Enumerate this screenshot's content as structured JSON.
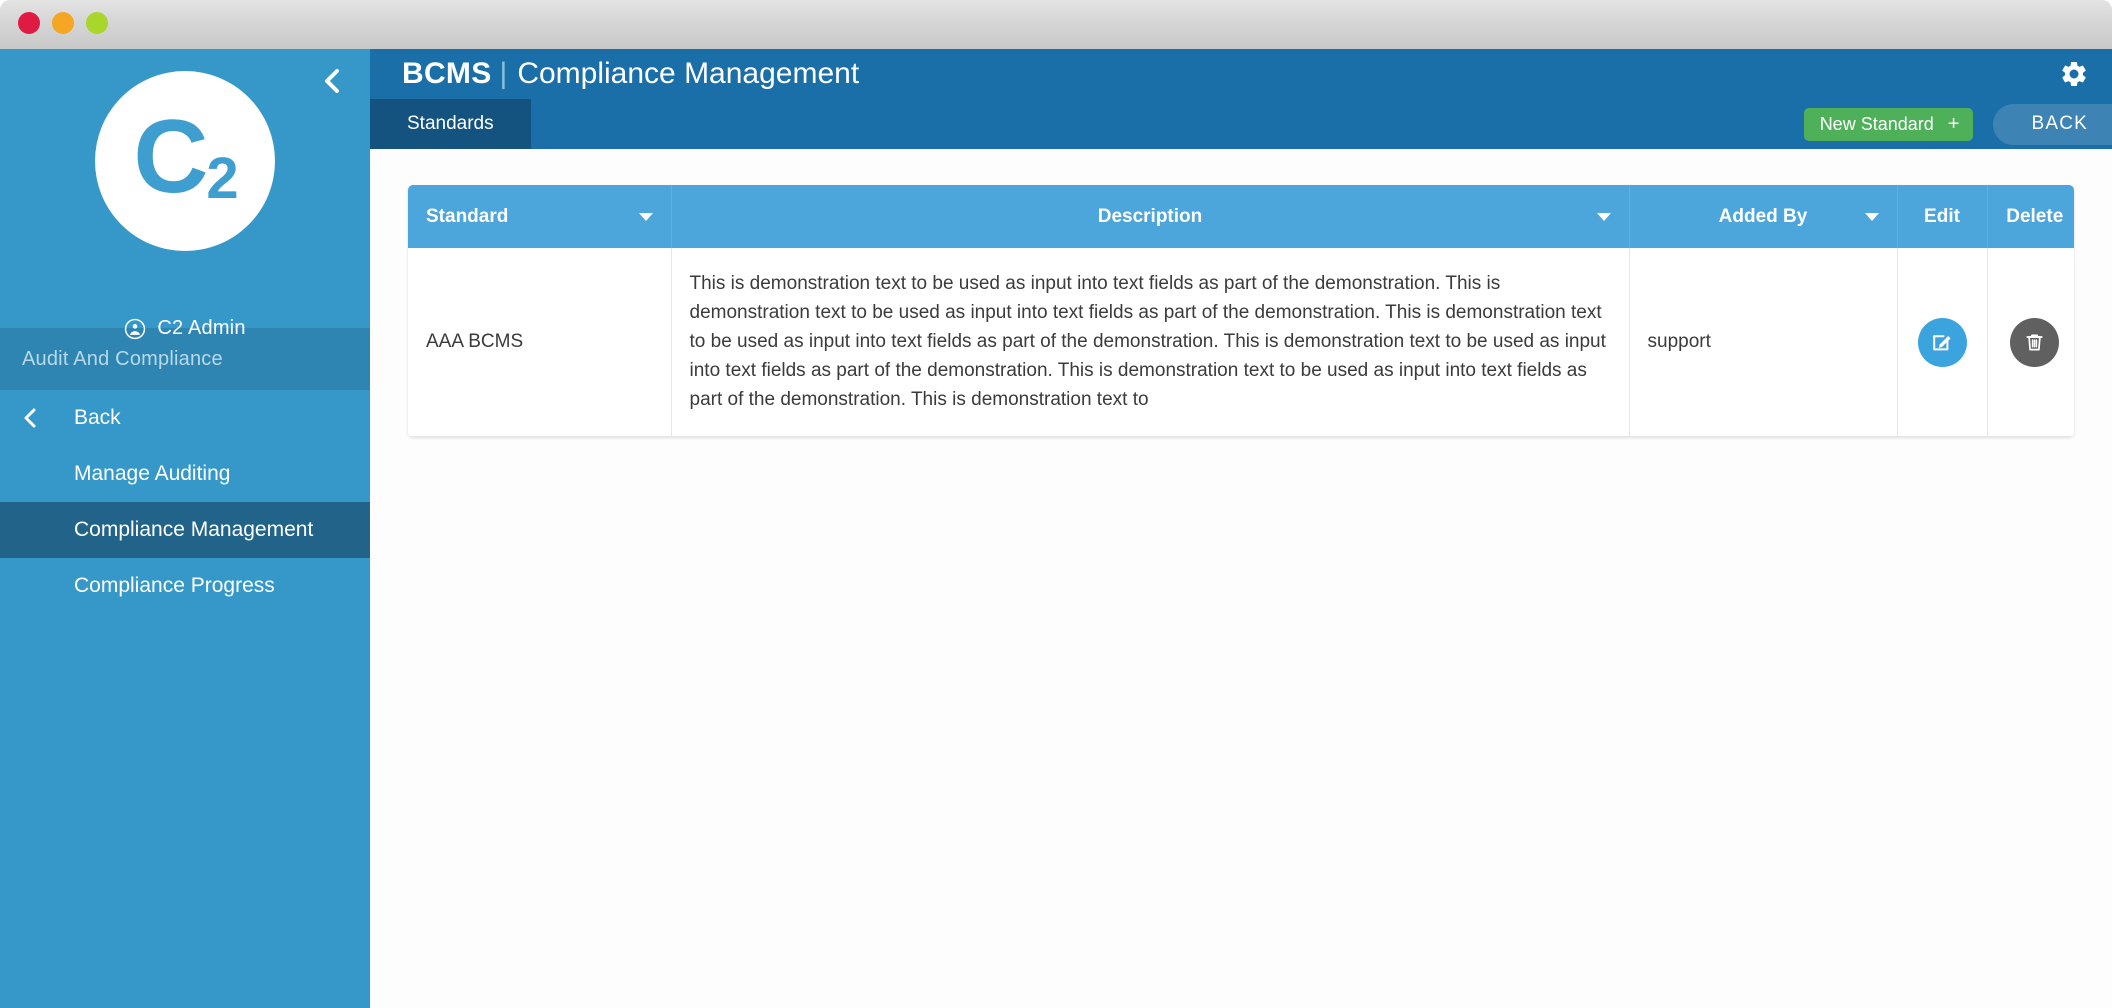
{
  "window": {
    "traffic_lights": [
      "close",
      "minimize",
      "zoom"
    ]
  },
  "sidebar": {
    "collapse_icon": "chevron-left-icon",
    "logo": {
      "main": "C",
      "sub": "2",
      "alt": "C2 logo"
    },
    "user": {
      "icon": "user-circle-icon",
      "name": "C2 Admin"
    },
    "section_label": "Audit And Compliance",
    "items": [
      {
        "label": "Back",
        "icon": "chevron-left-icon",
        "active": false
      },
      {
        "label": "Manage Auditing",
        "icon": null,
        "active": false
      },
      {
        "label": "Compliance Management",
        "icon": null,
        "active": true
      },
      {
        "label": "Compliance Progress",
        "icon": null,
        "active": false
      }
    ]
  },
  "header": {
    "brand": "BCMS",
    "divider": "|",
    "page_title": "Compliance Management",
    "gear_icon": "gear-icon"
  },
  "subbar": {
    "tab_label": "Standards",
    "new_standard_label": "New Standard",
    "new_standard_plus": "+",
    "back_label": "BACK"
  },
  "table": {
    "columns": [
      {
        "key": "standard",
        "label": "Standard",
        "sortable": true
      },
      {
        "key": "description",
        "label": "Description",
        "sortable": true
      },
      {
        "key": "added_by",
        "label": "Added By",
        "sortable": true
      },
      {
        "key": "edit",
        "label": "Edit",
        "sortable": false
      },
      {
        "key": "delete",
        "label": "Delete",
        "sortable": false
      }
    ],
    "rows": [
      {
        "standard": "AAA BCMS",
        "description": "This is demonstration text to be used as input into text fields as part of the demonstration. This is demonstration text to be used as input into text fields as part of the demonstration. This is demonstration text to be used as input into text fields as part of the demonstration. This is demonstration text to be used as input into text fields as part of the demonstration. This is demonstration text to be used as input into text fields as part of the demonstration. This is demonstration text to",
        "added_by": "support",
        "edit_icon": "edit-pencil-square-icon",
        "delete_icon": "trash-icon"
      }
    ]
  },
  "colors": {
    "sidebar": "#3698c8",
    "sidebar_section": "#2e85b2",
    "sidebar_active": "#216389",
    "header": "#1b6fa8",
    "tab_active": "#14537f",
    "table_header": "#4ca6dc",
    "accent_green": "#4fb05a",
    "back_button": "#3d84b5",
    "edit_button": "#3ba3dd",
    "delete_button": "#606060",
    "logo_text": "#3f9ed0"
  }
}
